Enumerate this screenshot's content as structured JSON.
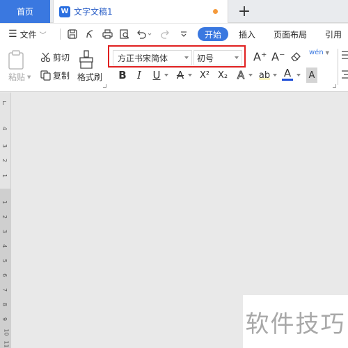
{
  "tabs": {
    "home_label": "首页",
    "doc_label": "文字文稿1",
    "doc_icon_letter": "W",
    "new_tab_symbol": "+"
  },
  "menu": {
    "file_label": "文件",
    "start_label": "开始",
    "insert_label": "插入",
    "layout_label": "页面布局",
    "reference_label": "引用"
  },
  "ribbon": {
    "paste_label": "粘贴",
    "cut_label": "剪切",
    "copy_label": "复制",
    "format_painter_label": "格式刷",
    "font_name": "方正书宋简体",
    "font_size": "初号",
    "bold": "B",
    "italic": "I",
    "underline": "U",
    "strike": "A",
    "superscript": "X²",
    "subscript": "X₂",
    "text_effect": "A",
    "highlight": "ab",
    "font_color": "A",
    "char_shading": "A",
    "grow_font": "A⁺",
    "shrink_font": "A⁻",
    "phonetic": "wén"
  },
  "ruler_numbers": [
    "4",
    "3",
    "2",
    "1",
    "1",
    "2",
    "3",
    "4",
    "5",
    "6",
    "7",
    "8",
    "9",
    "10",
    "11"
  ],
  "watermark": "软件技巧",
  "colors": {
    "accent": "#3a78e0",
    "highlight_frame": "#e02020",
    "modified_dot": "#f59a3b",
    "font_color_bar": "#1f4fd8"
  }
}
